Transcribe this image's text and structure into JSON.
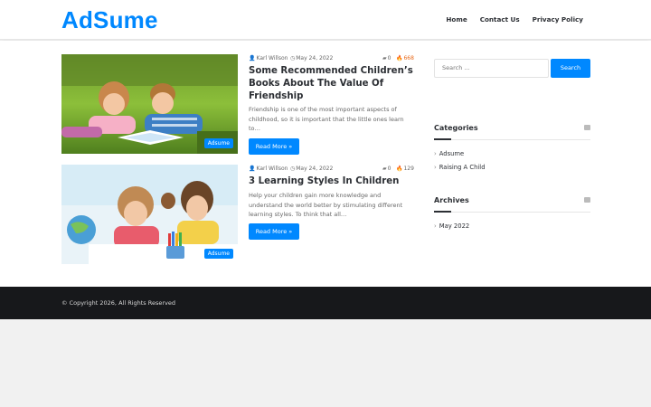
{
  "site": {
    "logo": "AdSume",
    "nav": [
      "Home",
      "Contact Us",
      "Privacy Policy"
    ]
  },
  "posts": [
    {
      "author": "Karl Willson",
      "date": "May 24, 2022",
      "comments": "0",
      "views": "668",
      "title": "Some Recommended Children’s Books About The Value Of Friendship",
      "excerpt": "Friendship is one of the most important aspects of childhood, so it is important that the little ones learn to…",
      "category": "Adsume",
      "more": "Read More »"
    },
    {
      "author": "Karl Willson",
      "date": "May 24, 2022",
      "comments": "0",
      "views": "129",
      "title": "3 Learning Styles In Children",
      "excerpt": "Help your children gain more knowledge and understand the world better by stimulating different learning styles. To think that all…",
      "category": "Adsume",
      "more": "Read More »"
    }
  ],
  "sidebar": {
    "search_placeholder": "Search ...",
    "search_button": "Search",
    "categories_title": "Categories",
    "categories": [
      "Adsume",
      "Raising A Child"
    ],
    "archives_title": "Archives",
    "archives": [
      "May 2022"
    ]
  },
  "footer": {
    "copyright": "© Copyright 2026, All Rights Reserved"
  },
  "colors": {
    "accent": "#0088ff",
    "footer_bg": "#17181b",
    "hot_views": "#e86a1c"
  }
}
